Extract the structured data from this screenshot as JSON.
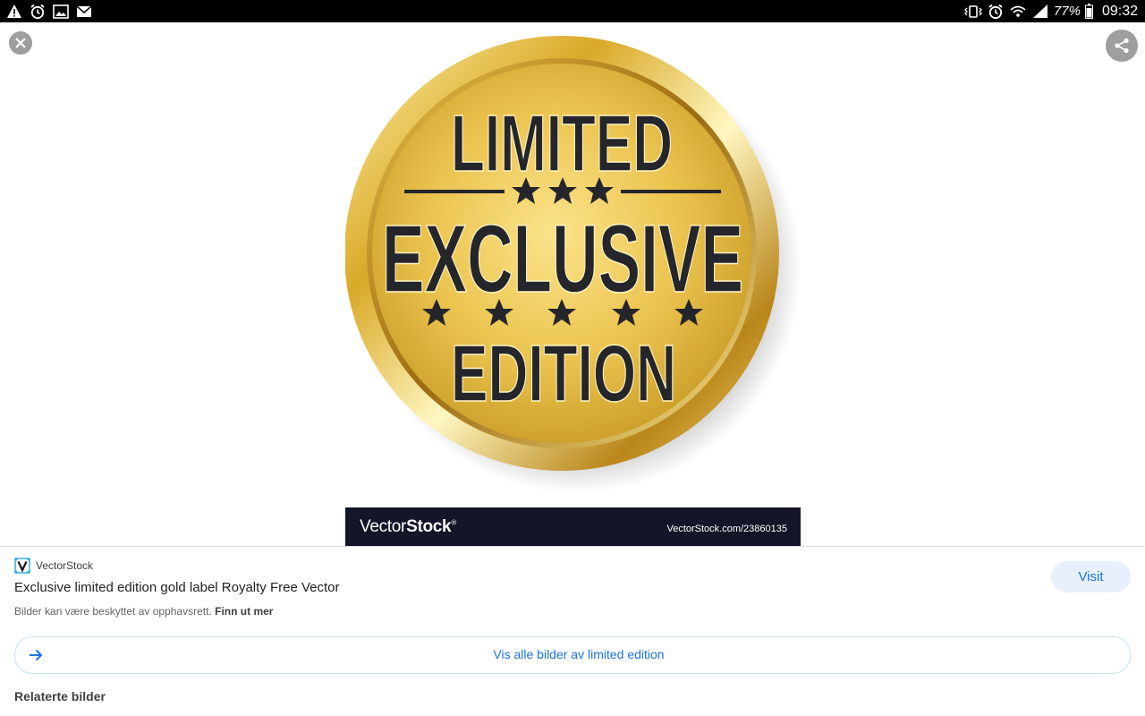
{
  "status_bar": {
    "left_icons": [
      "warning-icon",
      "alarm-icon",
      "image-icon",
      "mail-icon"
    ],
    "right_icons": [
      "vibrate-icon",
      "alarm-icon",
      "wifi-icon",
      "signal-icon",
      "battery-icon"
    ],
    "battery": "77%",
    "time": "09:32"
  },
  "viewer": {
    "close_icon": "close-icon",
    "share_icon": "share-icon"
  },
  "image": {
    "badge_line1": "LIMITED",
    "badge_line2": "EXCLUSIVE",
    "badge_line3": "EDITION",
    "watermark_brand_a": "Vector",
    "watermark_brand_b": "Stock",
    "watermark_mark": "®",
    "watermark_ref": "VectorStock.com/23860135",
    "colors": {
      "gold": "#e7c34e",
      "dark": "#25262b",
      "banner": "#131628"
    }
  },
  "result": {
    "source_name": "VectorStock",
    "title": "Exclusive limited edition gold label Royalty Free Vector",
    "copyright_text": "Bilder kan være beskyttet av opphavsrett.",
    "copyright_link": "Finn ut mer",
    "visit_label": "Visit"
  },
  "see_all": {
    "label": "Vis alle bilder av limited edition"
  },
  "related": {
    "heading": "Relaterte bilder"
  },
  "accent_color": "#1a73e8"
}
